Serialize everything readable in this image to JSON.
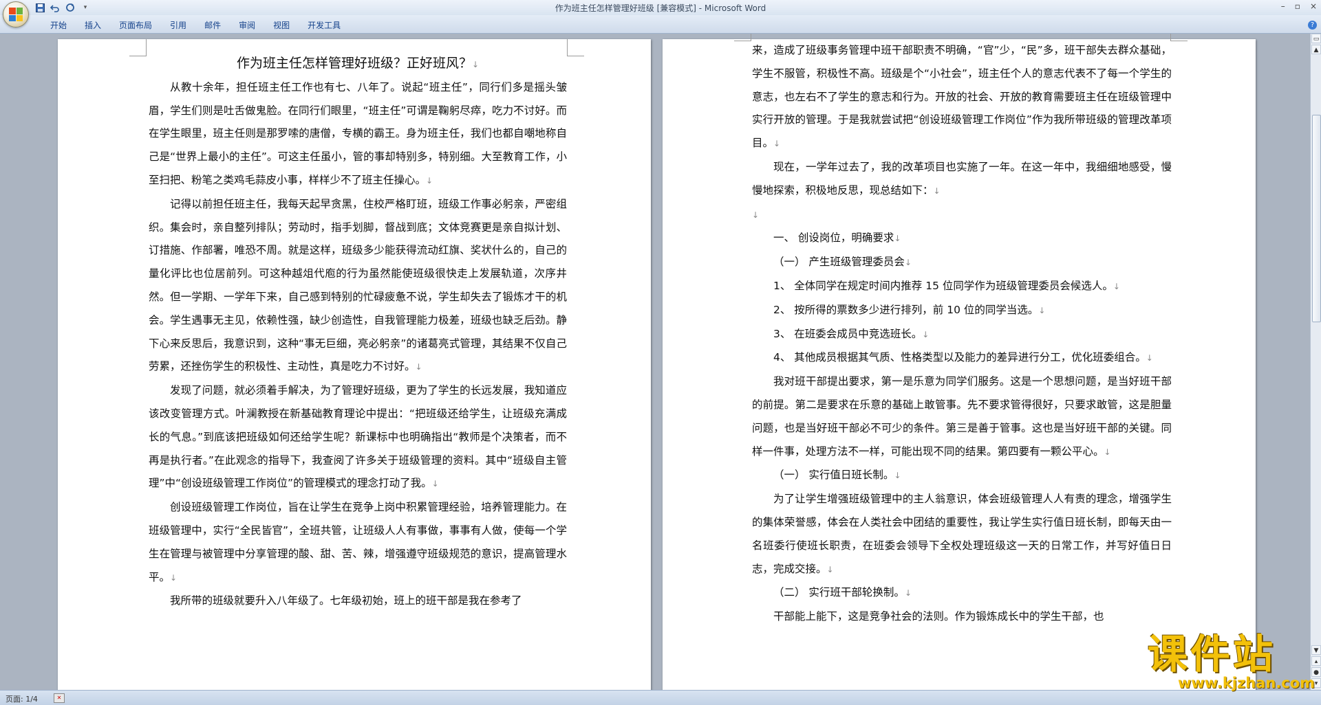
{
  "window": {
    "title": "作为班主任怎样管理好班级 [兼容模式] - Microsoft Word",
    "controls": {
      "minimize": "–",
      "restore": "▫",
      "close": "×"
    }
  },
  "quick_access": {
    "save": "💾",
    "undo": "↶",
    "redo": "↻",
    "customize": "▾"
  },
  "menu": {
    "tabs": [
      "开始",
      "插入",
      "页面布局",
      "引用",
      "邮件",
      "审阅",
      "视图",
      "开发工具"
    ],
    "help": "?"
  },
  "document": {
    "page1": {
      "title": "作为班主任怎样管理好班级？正好班风？",
      "paragraphs": [
        "从教十余年，担任班主任工作也有七、八年了。说起“班主任”，同行们多是摇头皱眉，学生们则是吐舌做鬼脸。在同行们眼里，“班主任”可谓是鞠躬尽瘁，吃力不讨好。而在学生眼里，班主任则是那罗嗦的唐僧，专横的霸王。身为班主任，我们也都自嘲地称自己是“世界上最小的主任”。可这主任虽小，管的事却特别多，特别细。大至教育工作，小至扫把、粉笔之类鸡毛蒜皮小事，样样少不了班主任操心。",
        "记得以前担任班主任，我每天起早贪黑，住校严格盯班，班级工作事必躬亲，严密组织。集会时，亲自整列排队；劳动时，指手划脚，督战到底；文体竞赛更是亲自拟计划、订措施、作部署，唯恐不周。就是这样，班级多少能获得流动红旗、奖状什么的，自己的量化评比也位居前列。可这种越俎代庖的行为虽然能使班级很快走上发展轨道，次序井然。但一学期、一学年下来，自己感到特别的忙碌疲惫不说，学生却失去了锻炼才干的机会。学生遇事无主见，依赖性强，缺少创造性，自我管理能力极差，班级也缺乏后劲。静下心来反思后，我意识到，这种“事无巨细，亮必躬亲”的诸葛亮式管理，其结果不仅自己劳累，还挫伤学生的积极性、主动性，真是吃力不讨好。",
        "发现了问题，就必须着手解决，为了管理好班级，更为了学生的长远发展，我知道应该改变管理方式。叶澜教授在新基础教育理论中提出：“把班级还给学生，让班级充满成长的气息。”到底该把班级如何还给学生呢？新课标中也明确指出“教师是个决策者，而不再是执行者。”在此观念的指导下，我查阅了许多关于班级管理的资料。其中“班级自主管理”中“创设班级管理工作岗位”的管理模式的理念打动了我。",
        "创设班级管理工作岗位，旨在让学生在竞争上岗中积累管理经验，培养管理能力。在班级管理中，实行“全民皆官”，全班共管，让班级人人有事做，事事有人做，使每一个学生在管理与被管理中分享管理的酸、甜、苦、辣，增强遵守班级规范的意识，提高管理水平。",
        "我所带的班级就要升入八年级了。七年级初始，班上的班干部是我在参考了"
      ]
    },
    "page2": {
      "paragraphs": [
        {
          "text": "来，造成了班级事务管理中班干部职责不明确，“官”少，“民”多，班干部失去群众基础，学生不服管，积极性不高。班级是个“小社会”，班主任个人的意志代表不了每一个学生的意志，也左右不了学生的意志和行为。开放的社会、开放的教育需要班主任在班级管理中实行开放的管理。于是我就尝试把“创设班级管理工作岗位”作为我所带班级的管理改革项目。",
          "indent": false
        },
        {
          "text": "现在，一学年过去了，我的改革项目也实施了一年。在这一年中，我细细地感受，慢慢地探索，积极地反思，现总结如下：",
          "indent": true
        },
        {
          "text": "",
          "indent": false
        },
        {
          "text": "一、 创设岗位，明确要求",
          "indent": true
        },
        {
          "text": "（一） 产生班级管理委员会",
          "indent": true
        },
        {
          "text": "1、 全体同学在规定时间内推荐 15 位同学作为班级管理委员会候选人。",
          "indent": true
        },
        {
          "text": "2、 按所得的票数多少进行排列，前 10 位的同学当选。",
          "indent": true
        },
        {
          "text": "3、 在班委会成员中竞选班长。",
          "indent": true
        },
        {
          "text": "4、 其他成员根据其气质、性格类型以及能力的差异进行分工，优化班委组合。",
          "indent": true
        },
        {
          "text": "我对班干部提出要求，第一是乐意为同学们服务。这是一个思想问题，是当好班干部的前提。第二是要求在乐意的基础上敢管事。先不要求管得很好，只要求敢管，这是胆量问题，也是当好班干部必不可少的条件。第三是善于管事。这也是当好班干部的关键。同样一件事，处理方法不一样，可能出现不同的结果。第四要有一颗公平心。",
          "indent": true
        },
        {
          "text": "（一） 实行值日班长制。",
          "indent": true
        },
        {
          "text": "为了让学生增强班级管理中的主人翁意识，体会班级管理人人有责的理念，增强学生的集体荣誉感，体会在人类社会中团结的重要性，我让学生实行值日班长制，即每天由一名班委行使班长职责，在班委会领导下全权处理班级这一天的日常工作，并写好值日日志，完成交接。",
          "indent": true
        },
        {
          "text": "（二） 实行班干部轮换制。",
          "indent": true
        },
        {
          "text": "干部能上能下，这是竞争社会的法则。作为锻炼成长中的学生干部，也",
          "indent": true
        }
      ]
    },
    "para_mark": "↓"
  },
  "status": {
    "page": "页面: 1/4"
  },
  "watermark": {
    "text": "课件站",
    "url": "www.kjzhan.com"
  }
}
